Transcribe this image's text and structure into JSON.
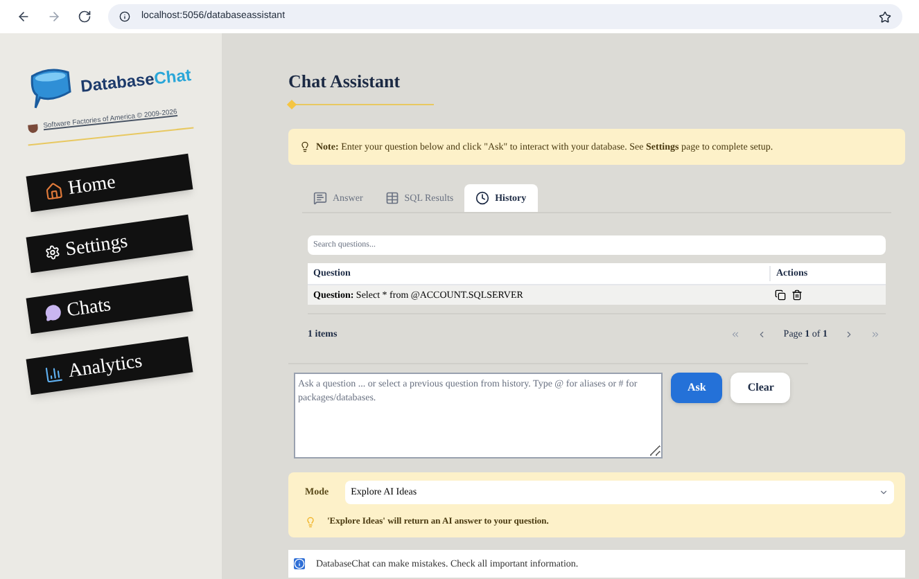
{
  "browser": {
    "url": "localhost:5056/databaseassistant"
  },
  "sidebar": {
    "logo_parts": [
      "Database",
      "Chat"
    ],
    "copyright": "Software Factories of America © 2009-2026",
    "items": [
      {
        "label": "Home",
        "kind": "home",
        "selected": false
      },
      {
        "label": "Settings",
        "kind": "settings",
        "selected": false
      },
      {
        "label": "Chats",
        "kind": "chats",
        "selected": false
      },
      {
        "label": "Analytics",
        "kind": "analytics",
        "selected": false
      }
    ]
  },
  "page_title": "Chat Assistant",
  "note": "**Note:** Enter your question below and click \"Ask\" to interact with your database. See **Settings** page to complete setup.",
  "tabs": [
    {
      "label": "Answer",
      "kind": "answer",
      "selected": false
    },
    {
      "label": "SQL Results",
      "kind": "table",
      "selected": false
    },
    {
      "label": "History",
      "kind": "history",
      "selected": true
    }
  ],
  "history": {
    "search_placeholder": "Search questions...",
    "columns": [
      "Question",
      "Actions"
    ],
    "rows": [
      {
        "prefix": "Question:",
        "question": "Select * from @ACCOUNT.SQLSERVER"
      }
    ],
    "count": "1 items",
    "page": "Page **1** of **1**"
  },
  "question_placeholder": "Ask a question ... or select a previous question from history. Type @ for aliases or # for packages/databases.",
  "buttons": [
    {
      "label": "Ask",
      "kind": "primary"
    },
    {
      "label": "Clear",
      "kind": "secondary"
    }
  ],
  "mode": {
    "label": "Mode",
    "value": "Explore AI Ideas",
    "hint": "'Explore Ideas' will return an AI answer to your question."
  },
  "disclaimer": "DatabaseChat can make mistakes. Check all important information."
}
